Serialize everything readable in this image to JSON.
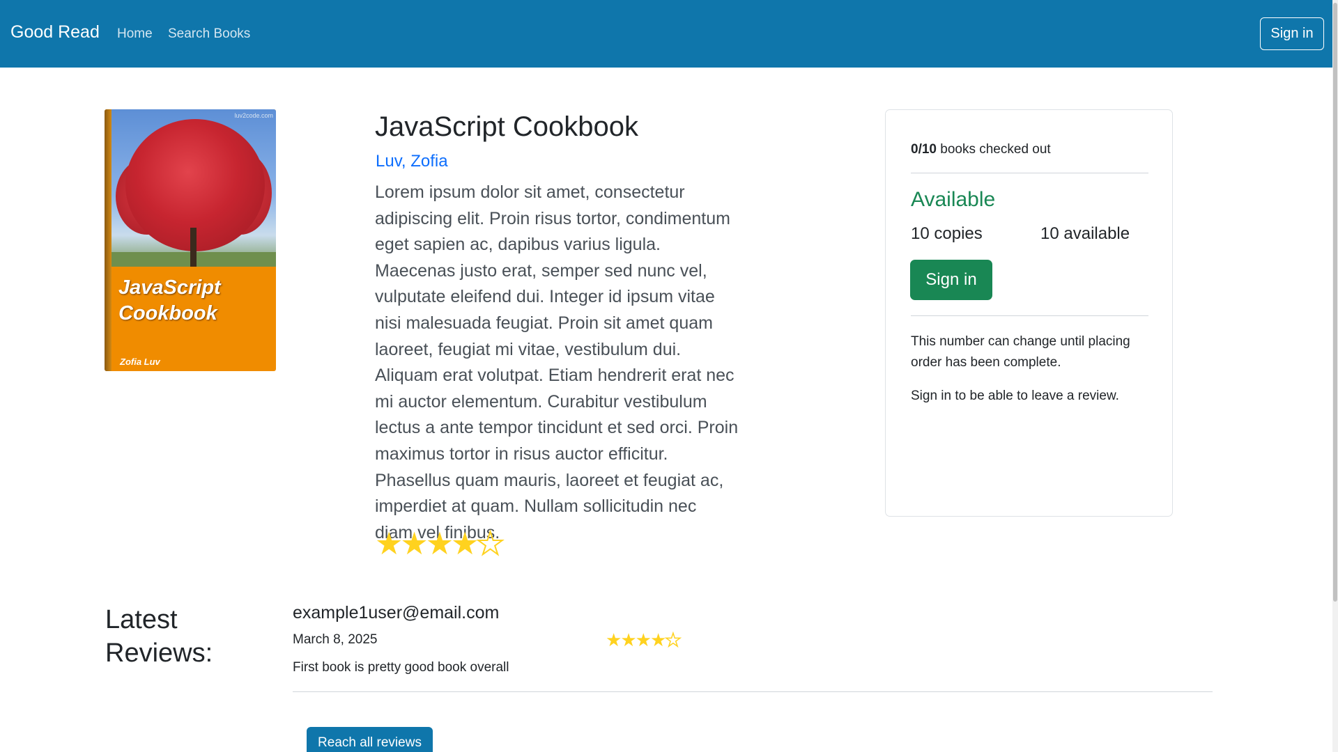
{
  "navbar": {
    "brand": "Good Read",
    "links": [
      "Home",
      "Search Books"
    ],
    "sign_in": "Sign in"
  },
  "book": {
    "title": "JavaScript Cookbook",
    "author": "Luv, Zofia",
    "description": "Lorem ipsum dolor sit amet, consectetur adipiscing elit. Proin risus tortor, condimentum eget sapien ac, dapibus varius ligula. Maecenas justo erat, semper sed nunc vel, vulputate eleifend dui. Integer id ipsum vitae nisi malesuada feugiat. Proin sit amet quam laoreet, feugiat mi vitae, vestibulum dui. Aliquam erat volutpat. Etiam hendrerit erat nec mi auctor elementum. Curabitur vestibulum lectus a ante tempor tincidunt et sed orci. Proin maximus tortor in risus auctor efficitur. Phasellus quam mauris, laoreet et feugiat ac, imperdiet at quam. Nullam sollicitudin nec diam vel finibus.",
    "rating": 4,
    "rating_max": 5,
    "cover": {
      "title_line1": "JavaScript",
      "title_line2": "Cookbook",
      "author": "Zofia Luv",
      "watermark": "luv2code.com"
    }
  },
  "availability": {
    "checked_out_count": "0/10",
    "checked_out_label": "books checked out",
    "status": "Available",
    "copies_count": "10",
    "copies_label": "copies",
    "available_count": "10",
    "available_label": "available",
    "sign_in": "Sign in",
    "note": "This number can change until placing order has been complete.",
    "review_note": "Sign in to be able to leave a review."
  },
  "reviews": {
    "heading_line1": "Latest",
    "heading_line2": "Reviews:",
    "items": [
      {
        "user": "example1user@email.com",
        "date": "March 8, 2025",
        "rating": 4,
        "text": "First book is pretty good book overall"
      }
    ],
    "reach_all": "Reach all reviews"
  },
  "colors": {
    "navbar": "#0f76ab",
    "link": "#0d6efd",
    "success": "#198754",
    "star": "#ffd21f"
  }
}
